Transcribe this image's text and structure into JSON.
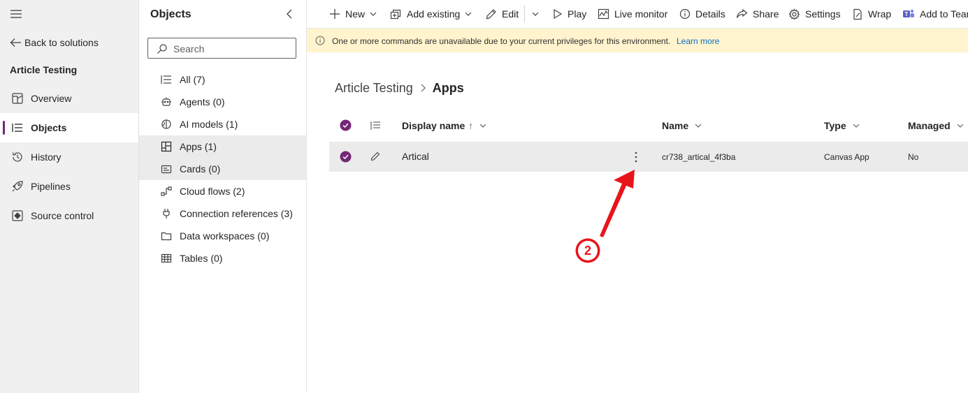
{
  "nav": {
    "back_label": "Back to solutions",
    "solution_title": "Article Testing",
    "items": [
      {
        "label": "Overview",
        "icon": "overview-icon"
      },
      {
        "label": "Objects",
        "icon": "objects-icon",
        "selected": true
      },
      {
        "label": "History",
        "icon": "history-icon"
      },
      {
        "label": "Pipelines",
        "icon": "rocket-icon"
      },
      {
        "label": "Source control",
        "icon": "source-control-icon"
      }
    ]
  },
  "objects": {
    "title": "Objects",
    "search_placeholder": "Search",
    "items": [
      {
        "label": "All  (7)",
        "icon": "list-icon"
      },
      {
        "label": "Agents  (0)",
        "icon": "bot-icon"
      },
      {
        "label": "AI models  (1)",
        "icon": "brain-icon"
      },
      {
        "label": "Apps  (1)",
        "icon": "apps-icon",
        "selected": true
      },
      {
        "label": "Cards  (0)",
        "icon": "card-icon"
      },
      {
        "label": "Cloud flows  (2)",
        "icon": "flow-icon"
      },
      {
        "label": "Connection references  (3)",
        "icon": "plug-icon"
      },
      {
        "label": "Data workspaces  (0)",
        "icon": "folder-icon"
      },
      {
        "label": "Tables  (0)",
        "icon": "table-icon"
      }
    ]
  },
  "toolbar": {
    "new": "New",
    "add_existing": "Add existing",
    "edit": "Edit",
    "play": "Play",
    "live_monitor": "Live monitor",
    "details": "Details",
    "share": "Share",
    "settings": "Settings",
    "wrap": "Wrap",
    "add_to_teams": "Add to Teams"
  },
  "warning": {
    "message": "One or more commands are unavailable due to your current privileges for this environment.",
    "link": "Learn more"
  },
  "breadcrumb": {
    "parent": "Article Testing",
    "current": "Apps"
  },
  "table": {
    "headers": {
      "display_name": "Display name",
      "sort_arrow": "↑",
      "name": "Name",
      "type": "Type",
      "managed": "Managed"
    },
    "rows": [
      {
        "display_name": "Artical",
        "name": "cr738_artical_4f3ba",
        "type": "Canvas App",
        "managed": "No"
      }
    ]
  },
  "annotation": {
    "number": "2",
    "color": "#e8141b"
  },
  "colors": {
    "accent": "#742774",
    "link": "#0f6cbd",
    "warning_bg": "#fff4ce"
  }
}
